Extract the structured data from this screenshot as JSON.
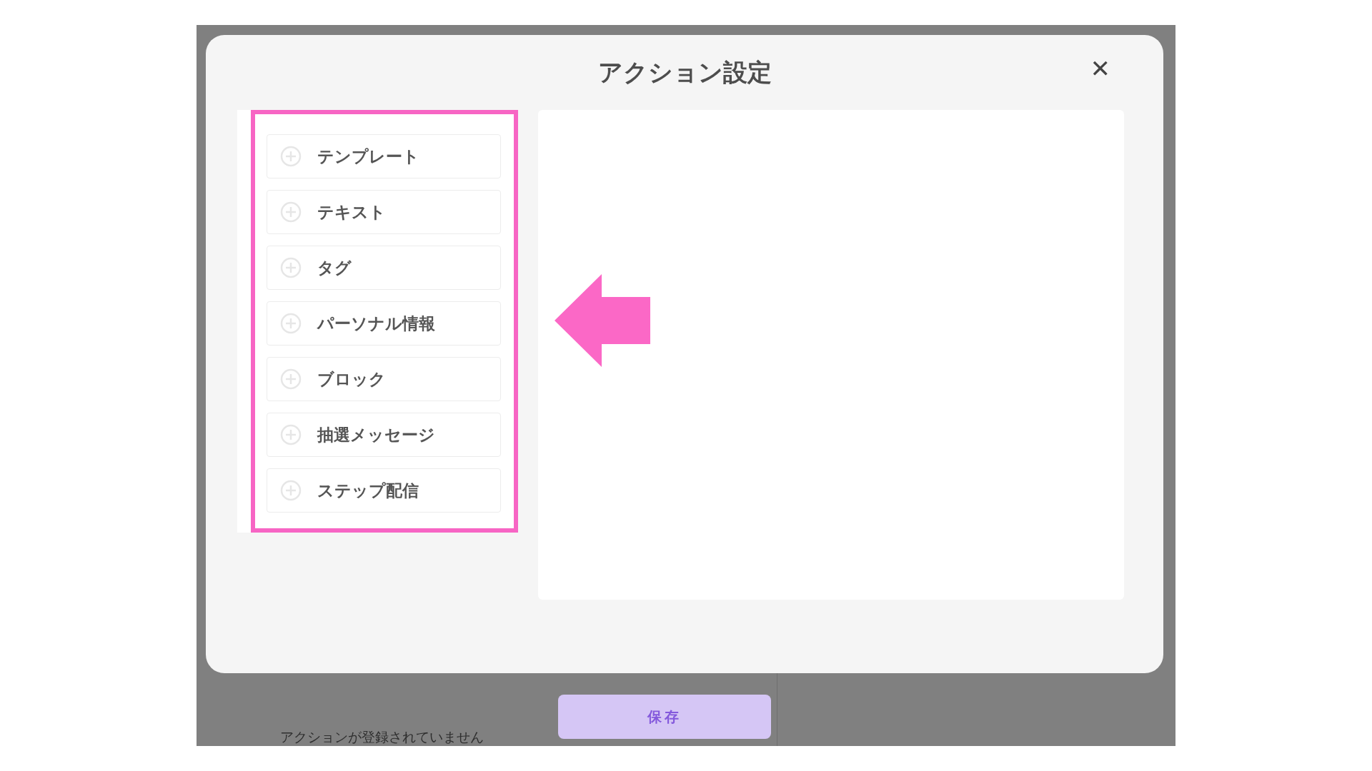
{
  "modal": {
    "title": "アクション設定",
    "close": "✕",
    "items": [
      "テンプレート",
      "テキスト",
      "タグ",
      "パーソナル情報",
      "ブロック",
      "抽選メッセージ",
      "ステップ配信"
    ]
  },
  "background": {
    "message": "アクションが登録されていません",
    "save_button": "保存"
  }
}
